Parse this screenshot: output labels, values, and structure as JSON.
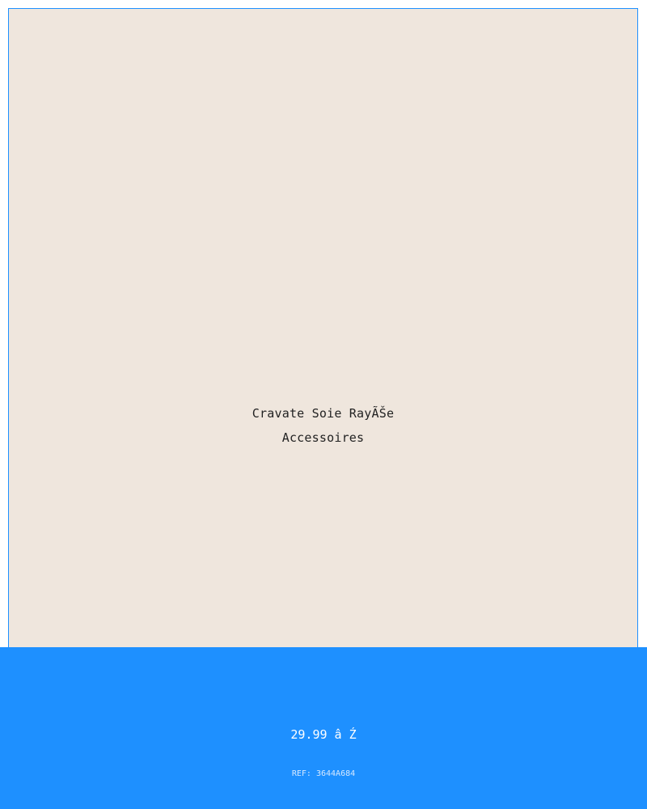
{
  "product": {
    "name": "Cravate Soie RayÃŠe",
    "category": "Accessoires",
    "price": "29.99 â Ź",
    "reference": "REF: 3644A684"
  },
  "colors": {
    "frame_background": "#EFE6DD",
    "accent": "#1E90FF",
    "text_dark": "#222222",
    "text_light": "#FFFFFF"
  }
}
